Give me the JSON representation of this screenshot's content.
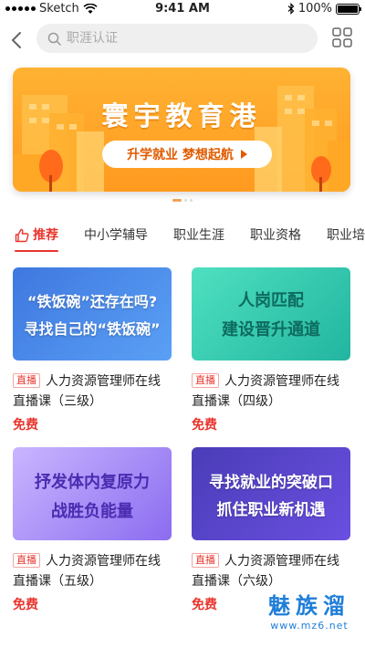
{
  "status_bar": {
    "carrier": "Sketch",
    "time": "9:41 AM",
    "battery": "100%"
  },
  "search": {
    "placeholder": "职涯认证"
  },
  "banner": {
    "title": "寰宇教育港",
    "subtitle": "升学就业 梦想起航",
    "pages": 3,
    "active_page": 1
  },
  "tabs": [
    {
      "label": "推荐",
      "active": true
    },
    {
      "label": "中小学辅导"
    },
    {
      "label": "职业生涯"
    },
    {
      "label": "职业资格"
    },
    {
      "label": "职业培"
    }
  ],
  "cards": [
    {
      "thumb_lines": [
        "“铁饭碗”还存在吗?",
        "寻找自己的“铁饭碗”"
      ],
      "badge": "直播",
      "title": "人力资源管理师在线直播课（三级）",
      "price": "免费"
    },
    {
      "thumb_lines": [
        "人岗匹配",
        "建设晋升通道"
      ],
      "badge": "直播",
      "title": "人力资源管理师在线直播课（四级）",
      "price": "免费"
    },
    {
      "thumb_lines": [
        "抒发体内复原力",
        "战胜负能量"
      ],
      "badge": "直播",
      "title": "人力资源管理师在线直播课（五级）",
      "price": "免费"
    },
    {
      "thumb_lines": [
        "寻找就业的突破口",
        "抓住职业新机遇"
      ],
      "badge": "直播",
      "title": "人力资源管理师在线直播课（六级）",
      "price": "免费"
    }
  ],
  "watermark": {
    "cn": "魅族溜",
    "en": "www.mz6.net"
  },
  "colors": {
    "accent": "#e8342c",
    "banner": "#ff9a1f"
  }
}
